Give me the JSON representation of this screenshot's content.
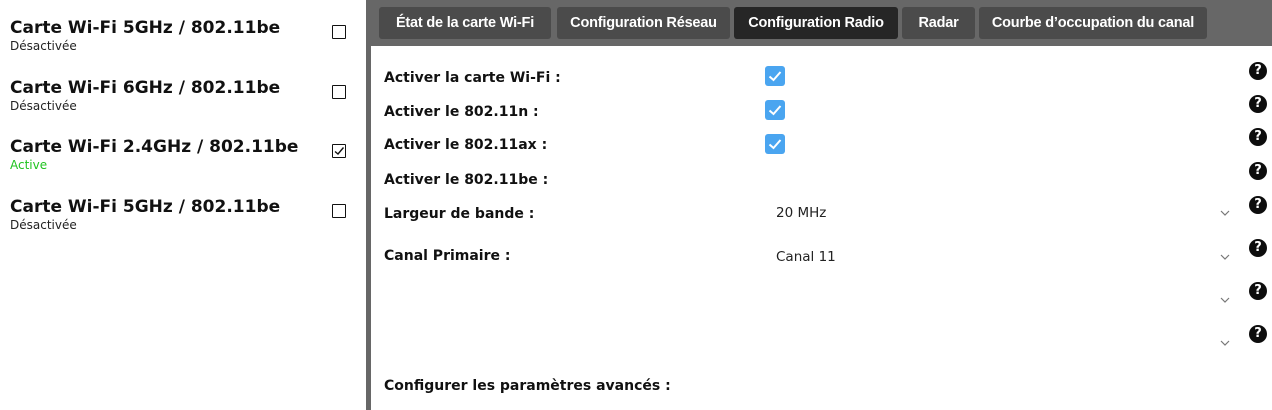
{
  "sidebar": {
    "cards": [
      {
        "title": "Carte Wi-Fi 5GHz / 802.11be",
        "status": "Désactivée",
        "active": false,
        "checked": false
      },
      {
        "title": "Carte Wi-Fi 6GHz / 802.11be",
        "status": "Désactivée",
        "active": false,
        "checked": false
      },
      {
        "title": "Carte Wi-Fi 2.4GHz / 802.11be",
        "status": "Active",
        "active": true,
        "checked": true
      },
      {
        "title": "Carte Wi-Fi 5GHz / 802.11be",
        "status": "Désactivée",
        "active": false,
        "checked": false
      }
    ]
  },
  "tabs": [
    {
      "label": "État de la carte Wi-Fi",
      "active": false
    },
    {
      "label": "Configuration Réseau",
      "active": false
    },
    {
      "label": "Configuration Radio",
      "active": true
    },
    {
      "label": "Radar",
      "active": false
    },
    {
      "label": "Courbe d’occupation du canal",
      "active": false
    }
  ],
  "form": {
    "wifi_label": "Activer la carte Wi-Fi :",
    "wifi_checked": true,
    "n_label": "Activer le 802.11n :",
    "n_checked": true,
    "ax_label": "Activer le 802.11ax :",
    "ax_checked": true,
    "be_label": "Activer le 802.11be :",
    "bandwidth_label": "Largeur de bande :",
    "bandwidth_value": "20 MHz",
    "primary_channel_label": "Canal Primaire :",
    "primary_channel_value": "Canal 11",
    "extra_select_1_value": "",
    "extra_select_2_value": "",
    "advanced_label": "Configurer les paramètres avancés :"
  },
  "help_glyph": "?",
  "colors": {
    "checkbox_blue": "#4aa5f0",
    "active_green": "#1fc31f",
    "tab_bg": "#4b4b4b",
    "tab_active_bg": "#262626",
    "bar_bg": "#676767"
  },
  "icons": {
    "help": "help-icon",
    "chevron": "chevron-down-icon",
    "check": "check-icon"
  }
}
